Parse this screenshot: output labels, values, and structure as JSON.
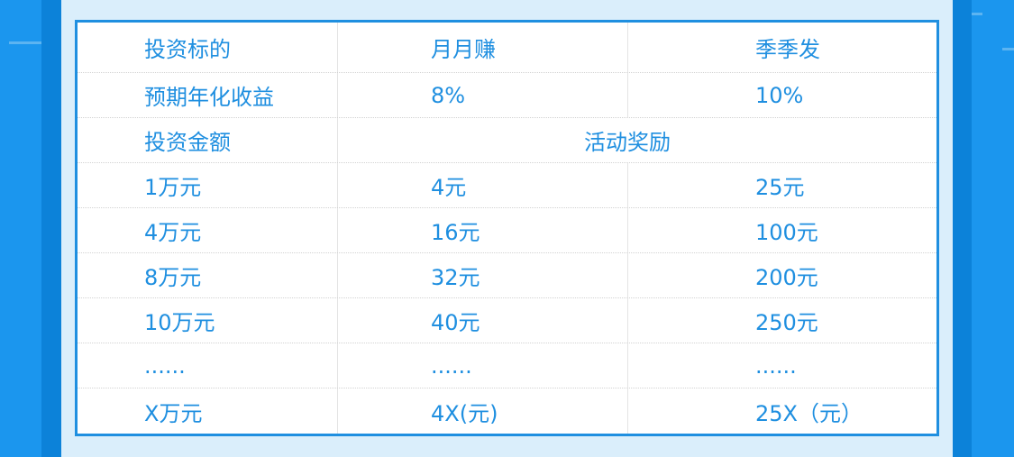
{
  "colors": {
    "background": "#1b96ee",
    "edge_strip": "#0c82d9",
    "panel": "#daeefb",
    "accent": "#1f8fe0",
    "table_bg": "#ffffff",
    "dash": "#5cb4f1"
  },
  "rate_table": {
    "product_header": {
      "label": "投资标的",
      "products": [
        "月月赚",
        "季季发"
      ]
    },
    "yield_row": {
      "label": "预期年化收益",
      "values": [
        "8%",
        "10%"
      ]
    },
    "reward_header": {
      "label": "投资金额",
      "title": "活动奖励"
    },
    "reward_rows": [
      {
        "amount": "1万元",
        "monthly": "4元",
        "quarterly": "25元"
      },
      {
        "amount": "4万元",
        "monthly": "16元",
        "quarterly": "100元"
      },
      {
        "amount": "8万元",
        "monthly": "32元",
        "quarterly": "200元"
      },
      {
        "amount": "10万元",
        "monthly": "40元",
        "quarterly": "250元"
      },
      {
        "amount": "......",
        "monthly": "......",
        "quarterly": "......"
      },
      {
        "amount": "X万元",
        "monthly": "4X(元)",
        "quarterly": "25X（元）"
      }
    ]
  }
}
